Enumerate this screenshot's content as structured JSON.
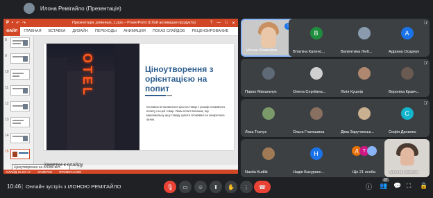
{
  "top": {
    "presenter": "Илона Ремігайло (Презентація)"
  },
  "powerpoint": {
    "title": "Презентація_ревенью_1.pps – PowerPoint (Сбой активации продукта)",
    "file_tab": "ФАЙЛ",
    "tabs": [
      "ГЛАВНАЯ",
      "ВСТАВКА",
      "ДИЗАЙН",
      "ПЕРЕХОДЫ",
      "АНИМАЦИЯ",
      "ПОКАЗ СЛАЙДОВ",
      "РЕЦЕНЗИРОВАНИЕ"
    ],
    "window_buttons": [
      "?",
      "—",
      "□",
      "✕"
    ],
    "thumbnails": [
      "8",
      "9",
      "10",
      "11",
      "12",
      "13",
      "14",
      "15"
    ],
    "tooltip": "Ціноутворення на основі вит...",
    "slide": {
      "photo_text": "OTEL",
      "title": "Ціноутворення з орієнтацією на попит",
      "body": "Основою встановлення ціни на товар є розмір споживчого попиту на цей товар. Яким попит високим, яку максимальну ціну товару купити споживачі за конкретною ціною."
    },
    "notes": "Заметки к слайду",
    "status": [
      "СЛАЙД 15 ИЗ 17",
      "ЗАМЕТКИ",
      "ПРИМЕЧАНИЯ"
    ]
  },
  "participants": [
    {
      "name": "Илона Ремігайло",
      "type": "video",
      "speaking": true
    },
    {
      "name": "Віталіна Каленс...",
      "initial": "В",
      "color": "#1e8e3e"
    },
    {
      "name": "Валентина Люб...",
      "type": "photo"
    },
    {
      "name": "Адріана Осадчук",
      "initial": "А",
      "color": "#1a73e8"
    },
    {
      "name": "Павло Михальчук",
      "type": "photo"
    },
    {
      "name": "Олена Сергіївна...",
      "type": "photo"
    },
    {
      "name": "Лілія Кушнір",
      "type": "photo"
    },
    {
      "name": "Вероніка Кравч...",
      "type": "photo"
    },
    {
      "name": "Лиза Ткачук",
      "type": "photo"
    },
    {
      "name": "Ольга Гнатишина",
      "type": "photo"
    },
    {
      "name": "Діма Заручинськ...",
      "type": "photo"
    },
    {
      "name": "Софія Данилко",
      "initial": "С",
      "color": "#12b5cb"
    },
    {
      "name": "Nastia Kudlik",
      "type": "photo"
    },
    {
      "name": "Надія Бахуринс...",
      "initial": "Н",
      "color": "#1a73e8"
    },
    {
      "name": "Ще 21 особа",
      "type": "more"
    },
    {
      "name": "Альона Климчук",
      "type": "video"
    }
  ],
  "bottom": {
    "time": "10:46",
    "separator": "|",
    "meeting": "Онлайн зустріч з ІЛОНОЮ РЕМІГАЙЛО",
    "participant_count": "37"
  },
  "colors": {
    "accent": "#d24726",
    "hangup": "#ea4335",
    "tile": "#3c4043"
  }
}
